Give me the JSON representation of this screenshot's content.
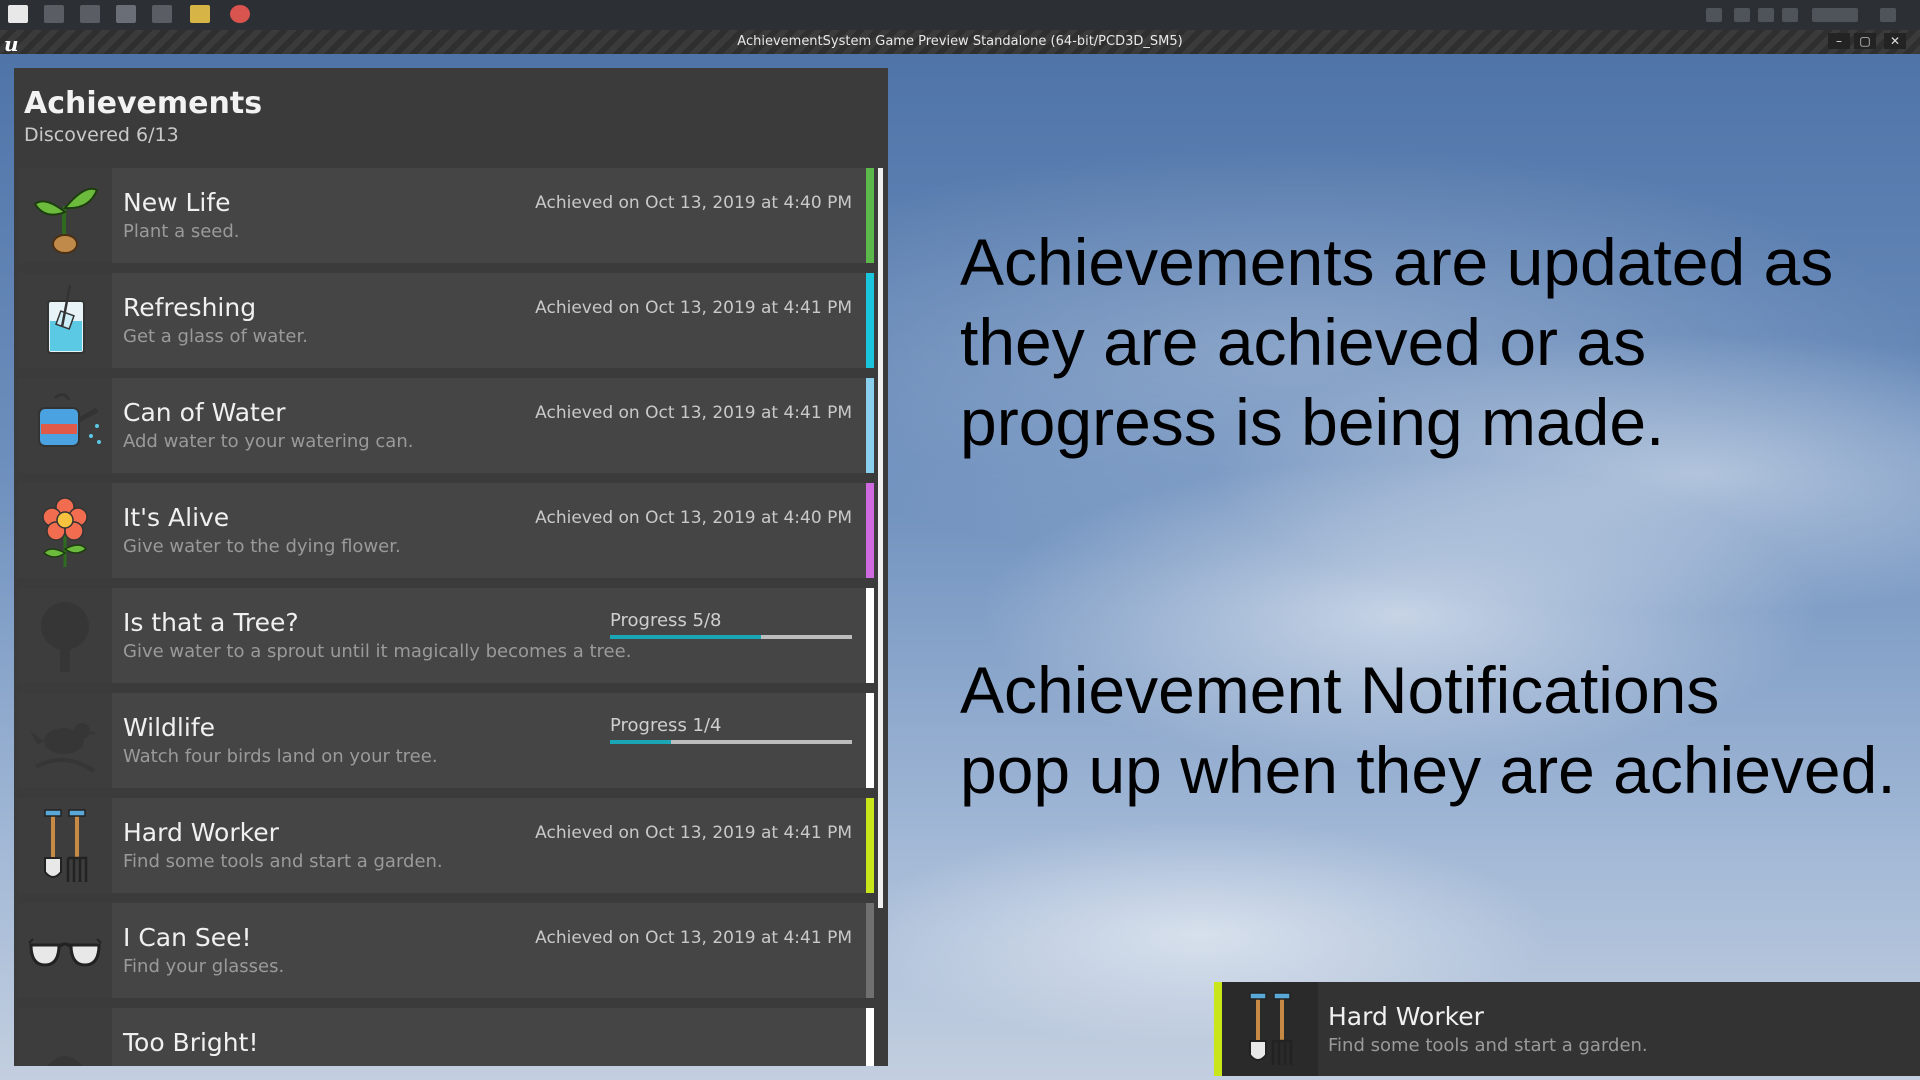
{
  "window": {
    "title": "AchievementSystem Game Preview Standalone (64-bit/PCD3D_SM5)",
    "logo": "u",
    "minimize": "–",
    "restore": "▢",
    "close": "✕"
  },
  "panel": {
    "title": "Achievements",
    "discovered": "Discovered 6/13"
  },
  "achievements": [
    {
      "name": "New Life",
      "desc": "Plant a seed.",
      "date": "Achieved on Oct 13, 2019 at 4:40 PM",
      "accent": "#5cb84a",
      "icon": "sprout-icon"
    },
    {
      "name": "Refreshing",
      "desc": "Get a glass of water.",
      "date": "Achieved on Oct 13, 2019 at 4:41 PM",
      "accent": "#19c6dd",
      "icon": "glass-of-water-icon"
    },
    {
      "name": "Can of Water",
      "desc": "Add water to your watering can.",
      "date": "Achieved on Oct 13, 2019 at 4:41 PM",
      "accent": "#8ad0ee",
      "icon": "watering-can-icon"
    },
    {
      "name": "It's Alive",
      "desc": "Give water to the dying flower.",
      "date": "Achieved on Oct 13, 2019 at 4:40 PM",
      "accent": "#d06ae0",
      "icon": "flower-icon"
    },
    {
      "name": "Is that a Tree?",
      "desc": "Give water to a sprout until it magically becomes a tree.",
      "progress_label": "Progress 5/8",
      "progress": 0.625,
      "accent": "#ffffff",
      "icon": "tree-icon"
    },
    {
      "name": "Wildlife",
      "desc": "Watch four birds land on your tree.",
      "progress_label": "Progress 1/4",
      "progress": 0.25,
      "accent": "#ffffff",
      "icon": "bird-icon"
    },
    {
      "name": "Hard Worker",
      "desc": "Find some tools and start a garden.",
      "date": "Achieved on Oct 13, 2019 at 4:41 PM",
      "accent": "#c8e619",
      "icon": "garden-tools-icon"
    },
    {
      "name": "I Can See!",
      "desc": "Find your glasses.",
      "date": "Achieved on Oct 13, 2019 at 4:41 PM",
      "accent": "#707070",
      "icon": "glasses-icon"
    },
    {
      "name": "Too Bright!",
      "desc": "",
      "accent": "#ffffff",
      "icon": "hat-icon"
    }
  ],
  "overlay": {
    "line1": "Achievements are updated as",
    "line2": "they are achieved or as",
    "line3": "progress is being made.",
    "line4": "Achievement Notifications",
    "line5": "pop up when they are achieved."
  },
  "notification": {
    "name": "Hard Worker",
    "desc": "Find some tools and start a garden.",
    "accent": "#c8e619",
    "icon": "garden-tools-icon"
  }
}
